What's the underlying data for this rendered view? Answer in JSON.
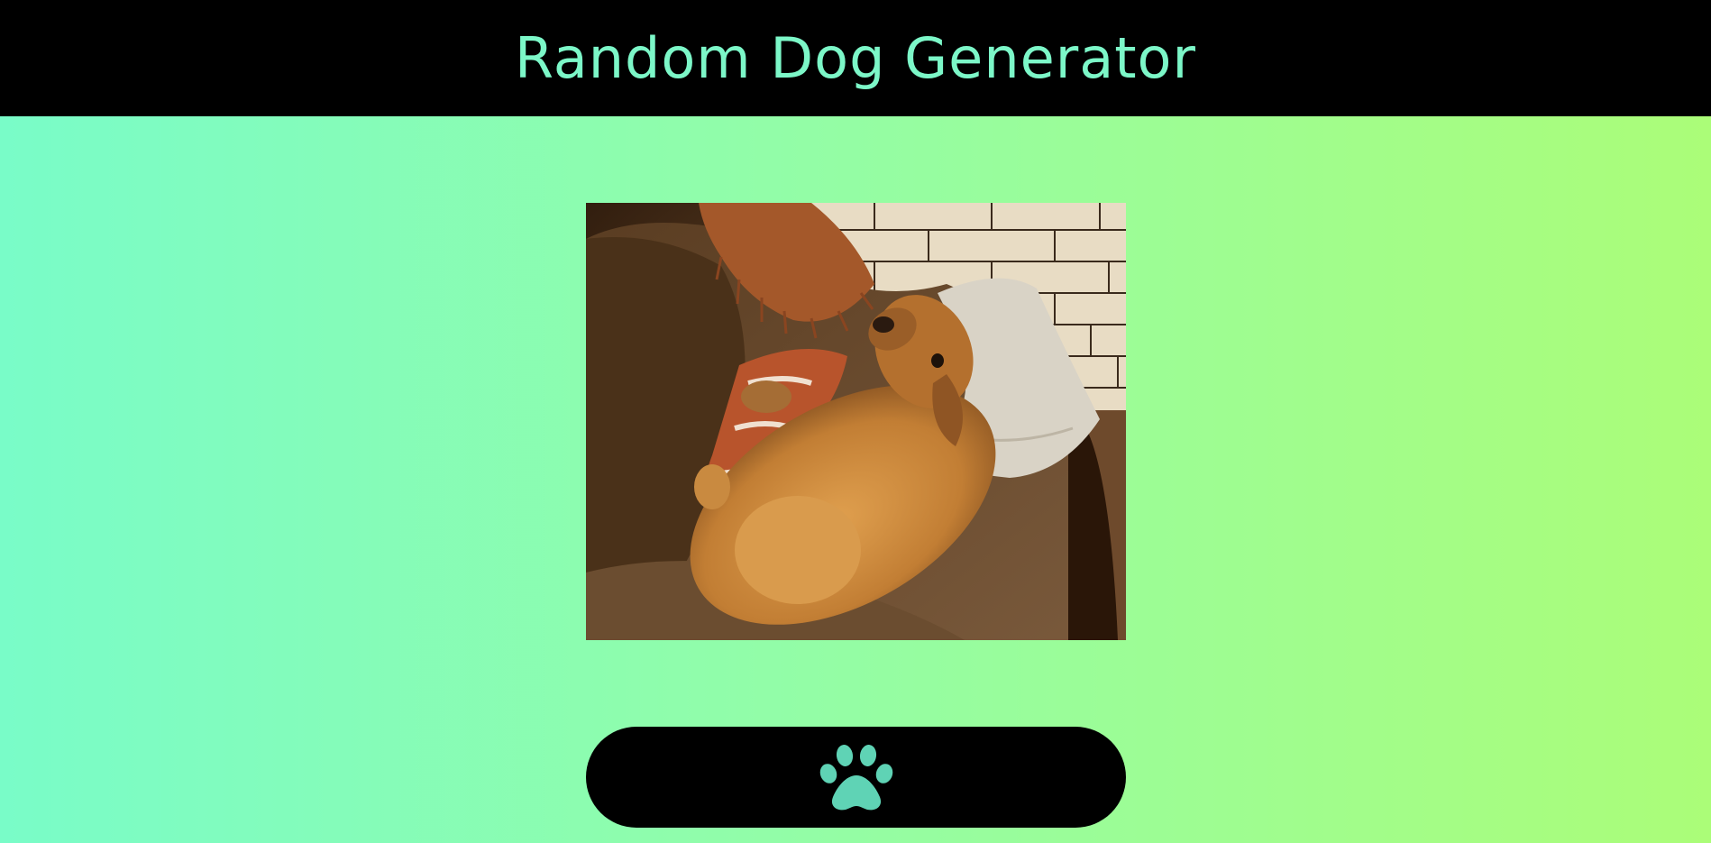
{
  "header": {
    "title": "Random Dog Generator"
  },
  "main": {
    "image_alt": "Random dog photo"
  },
  "button": {
    "icon": "paw-icon"
  },
  "colors": {
    "header_bg": "#000000",
    "title_color": "#7cf7c8",
    "gradient_start": "#79fcc8",
    "gradient_end": "#abfd78",
    "button_bg": "#000000",
    "paw_color": "#5fd3b5"
  }
}
